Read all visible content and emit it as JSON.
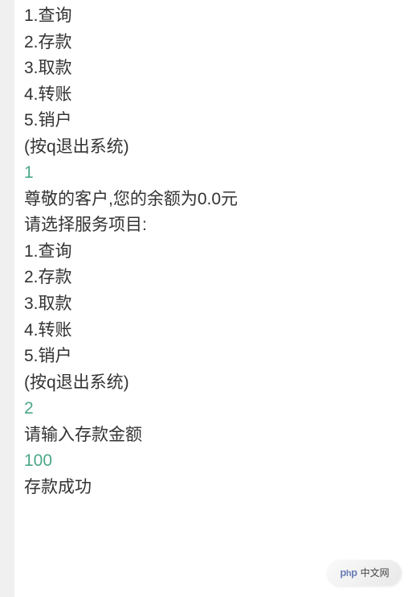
{
  "console": {
    "menu1": {
      "opt1": "1.查询",
      "opt2": "2.存款",
      "opt3": "3.取款",
      "opt4": "4.转账",
      "opt5": "5.销户",
      "quit": "(按q退出系统)"
    },
    "input1": "1",
    "balance_msg": "尊敬的客户,您的余额为0.0元",
    "blank": "",
    "prompt2": "请选择服务项目:",
    "menu2": {
      "opt1": "1.查询",
      "opt2": "2.存款",
      "opt3": "3.取款",
      "opt4": "4.转账",
      "opt5": "5.销户",
      "quit": "(按q退出系统)"
    },
    "input2": "2",
    "deposit_prompt": "请输入存款金额",
    "input3": "100",
    "deposit_success": "存款成功"
  },
  "watermark": {
    "brand_p": "p",
    "brand_h": "h",
    "brand_p2": "p",
    "text": "中文网"
  }
}
